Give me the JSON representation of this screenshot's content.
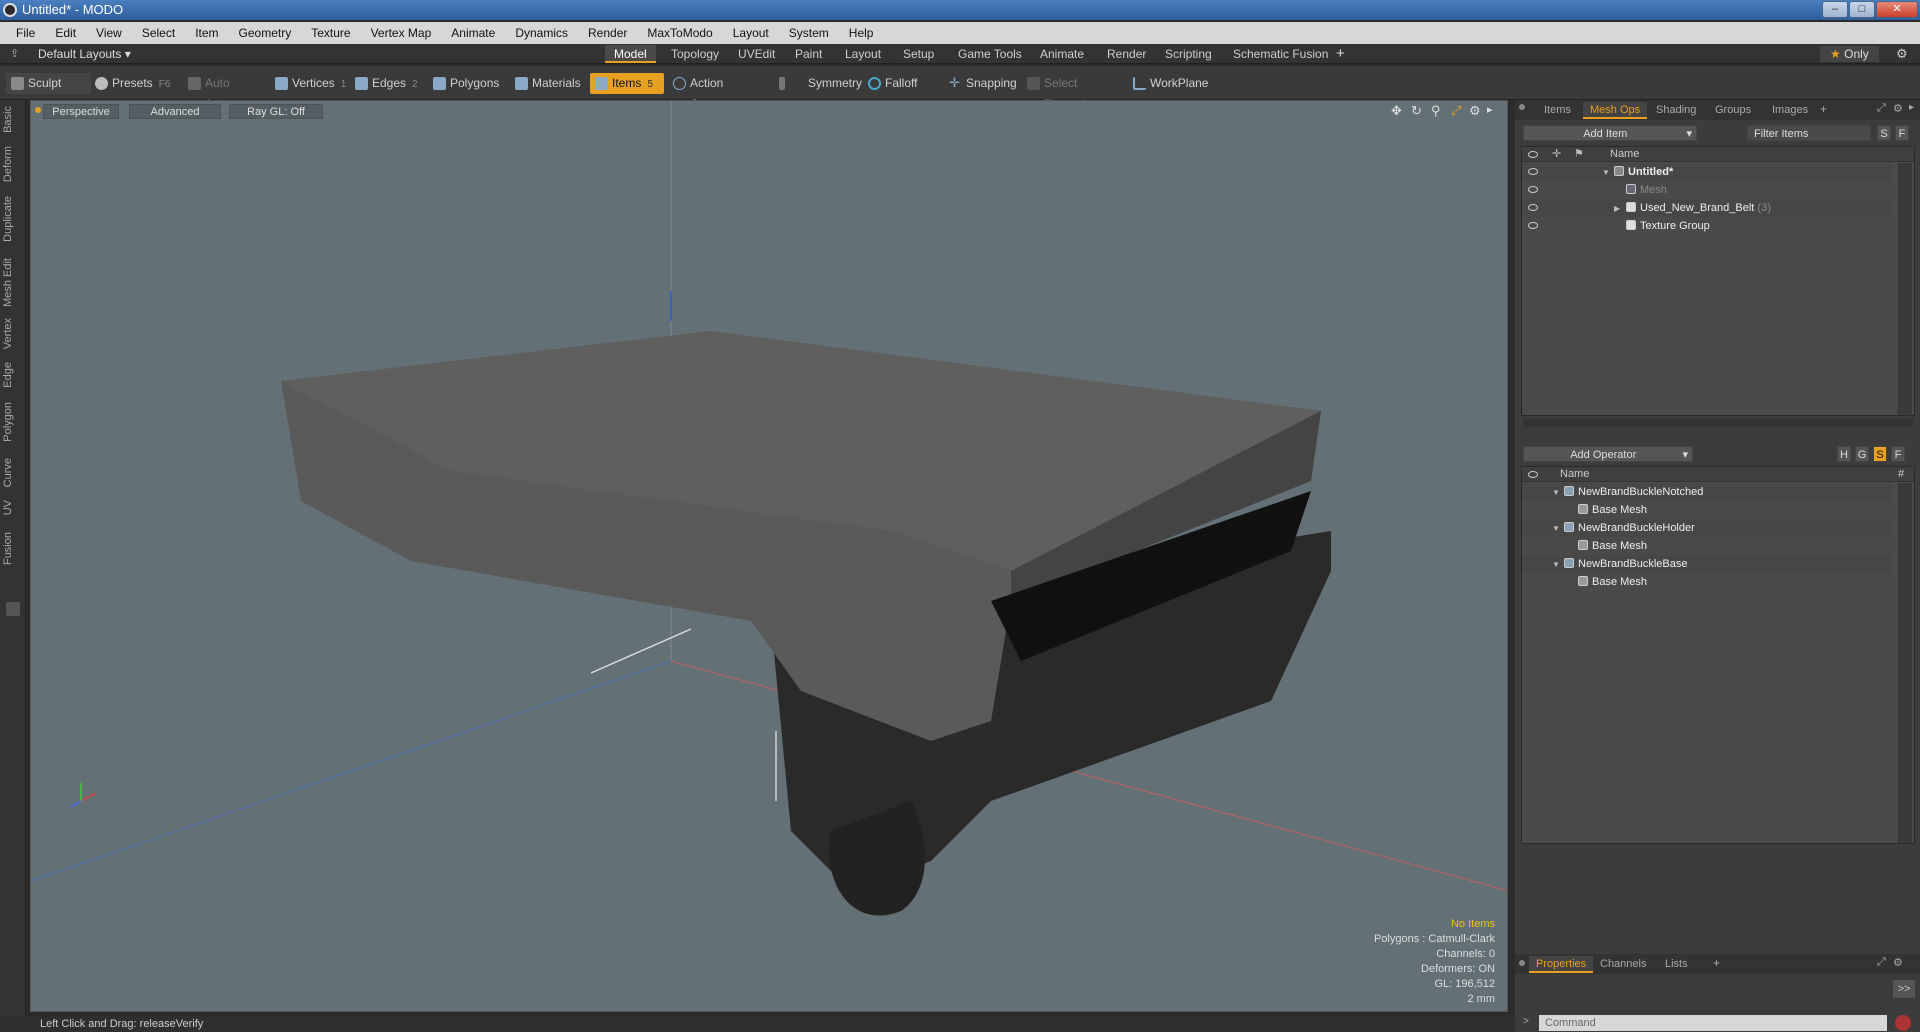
{
  "window": {
    "title": "Untitled* - MODO"
  },
  "menu": [
    "File",
    "Edit",
    "View",
    "Select",
    "Item",
    "Geometry",
    "Texture",
    "Vertex Map",
    "Animate",
    "Dynamics",
    "Render",
    "MaxToModo",
    "Layout",
    "System",
    "Help"
  ],
  "layout": {
    "preset": "Default Layouts",
    "tabs": [
      "Model",
      "Topology",
      "UVEdit",
      "Paint",
      "Layout",
      "Setup",
      "Game Tools",
      "Animate",
      "Render",
      "Scripting",
      "Schematic Fusion"
    ],
    "active_tab": "Model",
    "only_label": "Only"
  },
  "toolbar": {
    "sculpt": "Sculpt",
    "presets": "Presets",
    "presets_key": "F6",
    "auto_select": "Auto Select",
    "vertices": "Vertices",
    "vertices_key": "1",
    "edges": "Edges",
    "edges_key": "2",
    "polygons": "Polygons",
    "materials": "Materials",
    "items": "Items",
    "items_key": "5",
    "action_center": "Action Center",
    "symmetry": "Symmetry",
    "falloff": "Falloff",
    "snapping": "Snapping",
    "select_through": "Select Through",
    "workplane": "WorkPlane"
  },
  "left_tabs": [
    "Basic",
    "Deform",
    "Duplicate",
    "Mesh Edit",
    "Vertex",
    "Edge",
    "Polygon",
    "Curve",
    "UV",
    "Fusion"
  ],
  "viewport": {
    "view": "Perspective",
    "shading": "Advanced",
    "raygl": "Ray GL: Off",
    "info": {
      "no_items": "No Items",
      "polygons": "Polygons : Catmull-Clark",
      "channels": "Channels: 0",
      "deformers": "Deformers: ON",
      "gl": "GL: 196,512",
      "scale": "2 mm"
    }
  },
  "status": {
    "text": "Left Click and Drag:   releaseVerify"
  },
  "items_panel": {
    "tabs": [
      "Items",
      "Mesh Ops",
      "Shading",
      "Groups",
      "Images"
    ],
    "active_tab": "Mesh Ops",
    "add_item": "Add Item",
    "filter": "Filter Items",
    "s_btn": "S",
    "f_btn": "F",
    "column_name": "Name",
    "rows": [
      {
        "label": "Untitled*",
        "count": ""
      },
      {
        "label": "Mesh",
        "count": ""
      },
      {
        "label": "Used_New_Brand_Belt",
        "count": "(3)"
      },
      {
        "label": "Texture Group",
        "count": ""
      }
    ]
  },
  "meshops_panel": {
    "add_operator": "Add Operator",
    "column_name": "Name",
    "column_hash": "#",
    "rows": [
      {
        "label": "NewBrandBuckleNotched"
      },
      {
        "label": "Base Mesh"
      },
      {
        "label": "NewBrandBuckleHolder"
      },
      {
        "label": "Base Mesh"
      },
      {
        "label": "NewBrandBuckleBase"
      },
      {
        "label": "Base Mesh"
      }
    ]
  },
  "props_panel": {
    "tabs": [
      "Properties",
      "Channels",
      "Lists"
    ],
    "active_tab": "Properties",
    "command_placeholder": "Command"
  },
  "colors": {
    "accent": "#e8a020",
    "viewport_bg": "#637076"
  }
}
